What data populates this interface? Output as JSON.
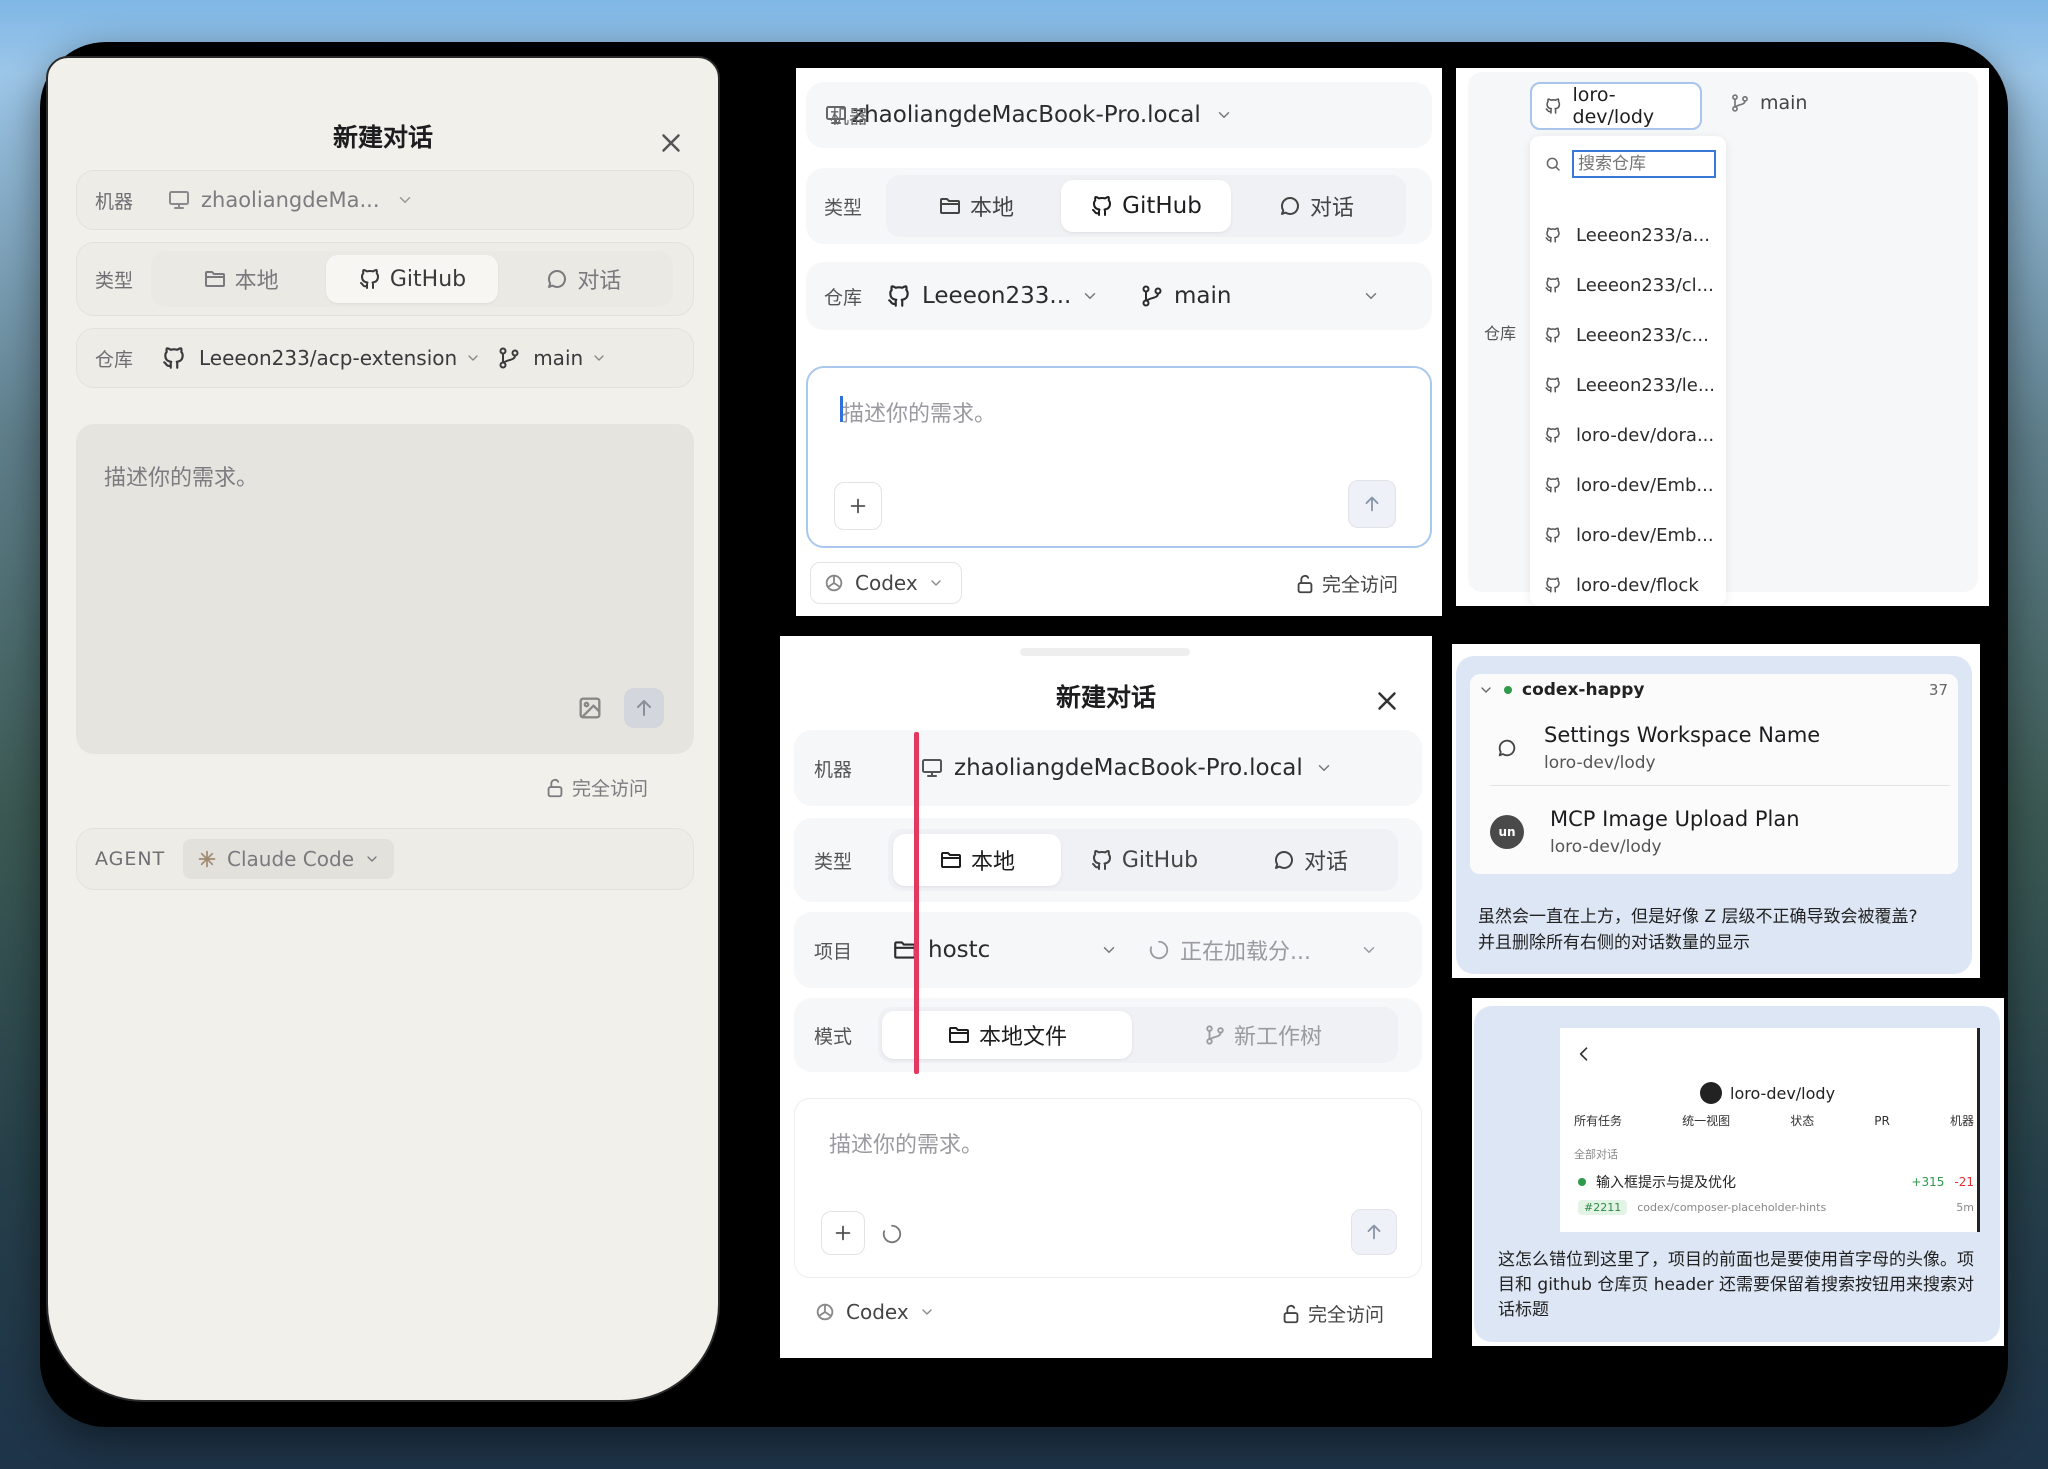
{
  "p1": {
    "title": "新建对话",
    "machine_label": "机器",
    "machine_value": "zhaoliangdeMa...",
    "type_label": "类型",
    "type_local": "本地",
    "type_github": "GitHub",
    "type_chat": "对话",
    "repo_label": "仓库",
    "repo_value": "Leeeon233/acp-extension",
    "branch": "main",
    "placeholder": "描述你的需求。",
    "access": "完全访问",
    "agent_label": "AGENT",
    "agent_value": "Claude Code"
  },
  "p2": {
    "machine_label": "机器",
    "machine_value": "zhaoliangdeMacBook-Pro.local",
    "type_label": "类型",
    "type_local": "本地",
    "type_github": "GitHub",
    "type_chat": "对话",
    "repo_label": "仓库",
    "repo_value": "Leeeon233...",
    "branch": "main",
    "placeholder": "描述你的需求。",
    "agent": "Codex",
    "access": "完全访问"
  },
  "p3": {
    "repo_selected": "loro-dev/lody",
    "branch": "main",
    "search_placeholder": "搜索仓库",
    "repo_label": "仓库",
    "repos": [
      "Leeeon233/a...",
      "Leeeon233/cl...",
      "Leeeon233/c...",
      "Leeeon233/le...",
      "loro-dev/dora...",
      "loro-dev/Emb...",
      "loro-dev/Emb...",
      "loro-dev/flock"
    ]
  },
  "p4": {
    "title": "新建对话",
    "machine_label": "机器",
    "machine_value": "zhaoliangdeMacBook-Pro.local",
    "type_label": "类型",
    "type_local": "本地",
    "type_github": "GitHub",
    "type_chat": "对话",
    "project_label": "项目",
    "project_value": "hostc",
    "loading": "正在加载分...",
    "mode_label": "模式",
    "mode_local": "本地文件",
    "mode_worktree": "新工作树",
    "placeholder": "描述你的需求。",
    "agent": "Codex",
    "access": "完全访问"
  },
  "p5": {
    "group": "codex-happy",
    "count": "37",
    "items": [
      {
        "title": "Settings Workspace Name",
        "sub": "loro-dev/lody"
      },
      {
        "title": "MCP Image Upload Plan",
        "sub": "loro-dev/lody"
      }
    ],
    "note": "虽然会一直在上方，但是好像 Z 层级不正确导致会被覆盖?\n并且删除所有右侧的对话数量的显示"
  },
  "p6": {
    "repo": "loro-dev/lody",
    "filters": [
      "所有任务",
      "统一视图",
      "状态",
      "PR",
      "机器"
    ],
    "section": "全部对话",
    "task": "输入框提示与提及优化",
    "add": "+315",
    "del": "-21",
    "pr": "#2211",
    "branch": "codex/composer-placeholder-hints",
    "time": "5m",
    "note": "这怎么错位到这里了，项目的前面也是要使用首字母的头像。项目和 github 仓库页 header 还需要保留着搜索按钮用来搜索对话标题"
  }
}
